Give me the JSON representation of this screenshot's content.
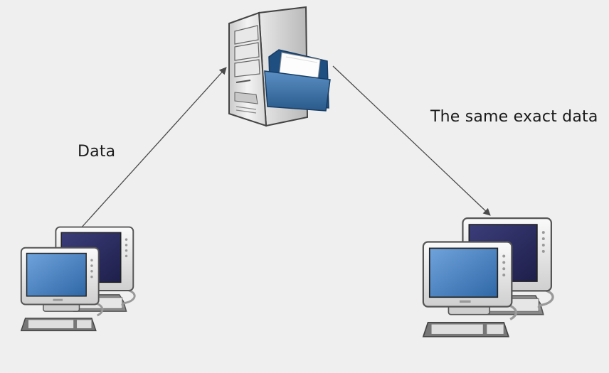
{
  "labels": {
    "upload": "Data",
    "download": "The same exact data"
  },
  "icons": {
    "server": "file-server-icon",
    "source": "workstations-icon",
    "destination": "workstations-icon"
  },
  "colors": {
    "background": "#efefef",
    "arrow": "#4a4a4a",
    "folder": "#2f6496",
    "screen_dark": "#2a2b5e",
    "screen_light": "#3d78b8"
  }
}
